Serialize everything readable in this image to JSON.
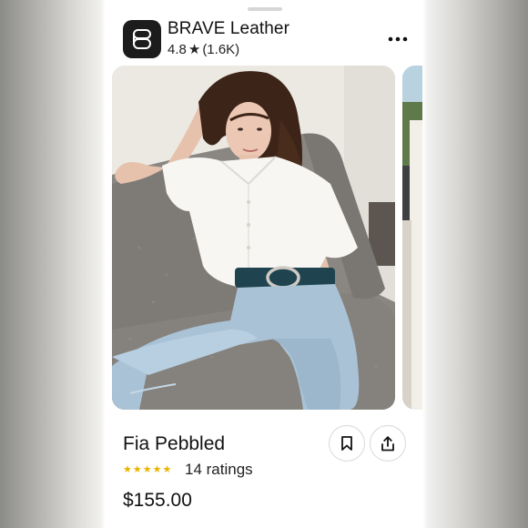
{
  "brand": {
    "name": "BRAVE Leather",
    "rating": "4.8",
    "rating_star": "★",
    "rating_count": "(1.6K)"
  },
  "product": {
    "title": "Fia Pebbled",
    "stars": [
      "★",
      "★",
      "★",
      "★",
      "★"
    ],
    "ratings_label": "14 ratings",
    "price": "$155.00"
  },
  "icons": {
    "logo": "brand-logo",
    "more": "more-icon",
    "save": "bookmark-icon",
    "share": "share-icon"
  },
  "colors": {
    "star": "#e8b400",
    "logo_bg": "#1c1c1c"
  }
}
